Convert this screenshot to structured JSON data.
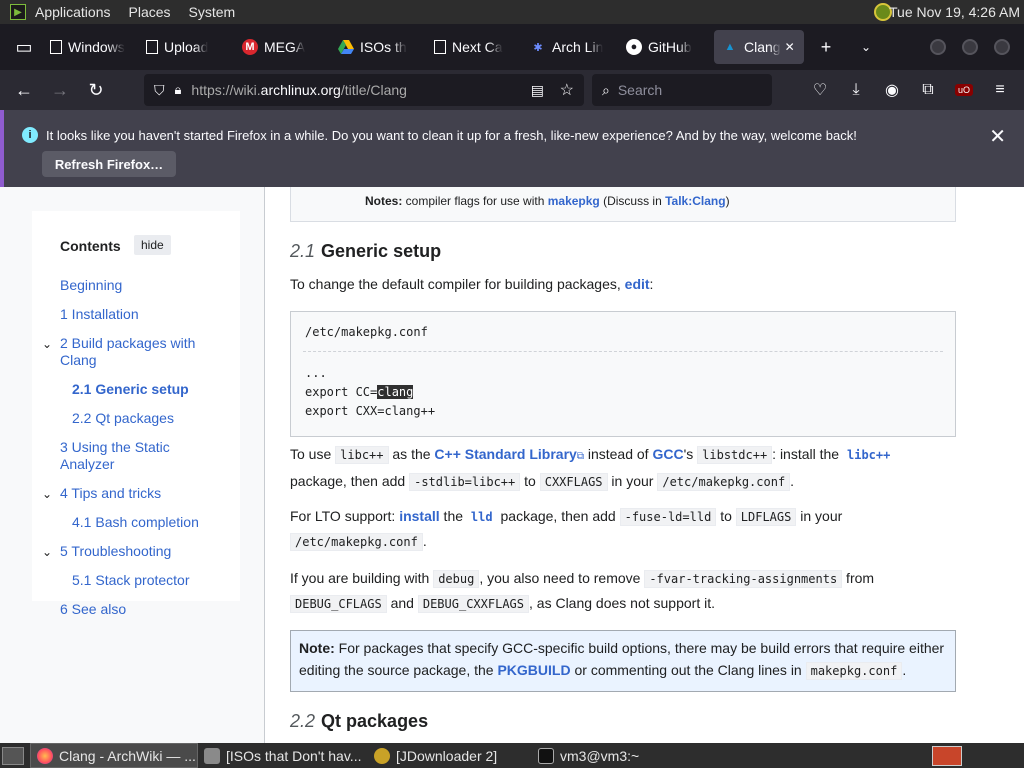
{
  "top_panel": {
    "menus": [
      "Applications",
      "Places",
      "System"
    ],
    "clock": "Tue Nov 19, 4:26 AM"
  },
  "tabs": [
    {
      "label": "Windows",
      "icon": "doc-icon"
    },
    {
      "label": "Upload",
      "icon": "doc-icon"
    },
    {
      "label": "MEGA",
      "icon": "mega-icon"
    },
    {
      "label": "ISOs th",
      "icon": "drive-icon"
    },
    {
      "label": "Next Ca",
      "icon": "doc-icon"
    },
    {
      "label": "Arch Lin",
      "icon": "bug-icon"
    },
    {
      "label": "GitHub",
      "icon": "github-icon"
    },
    {
      "label": "Clang",
      "icon": "arch-icon",
      "active": true
    }
  ],
  "nav": {
    "url_prefix": "https://wiki.",
    "url_domain": "archlinux.org",
    "url_path": "/title/Clang",
    "search_placeholder": "Search"
  },
  "notification": {
    "message": "It looks like you haven't started Firefox in a while. Do you want to clean it up for a fresh, like-new experience? And by the way, welcome back!",
    "button": "Refresh Firefox…"
  },
  "toc": {
    "title": "Contents",
    "hide": "hide",
    "items": [
      {
        "label": "Beginning"
      },
      {
        "label": "1  Installation"
      },
      {
        "label": "2  Build packages with",
        "label2": "Clang",
        "chevron": true
      },
      {
        "label": "2.1  Generic setup",
        "current": true
      },
      {
        "label": "2.2  Qt packages"
      },
      {
        "label": "3  Using the Static",
        "label2": "Analyzer"
      },
      {
        "label": "4  Tips and tricks",
        "chevron": true
      },
      {
        "label": "4.1  Bash completion"
      },
      {
        "label": "5  Troubleshooting",
        "chevron": true
      },
      {
        "label": "5.1  Stack protector"
      },
      {
        "label": "6  See also"
      }
    ]
  },
  "content": {
    "note_top": {
      "prefix": "Notes:",
      "text": " compiler flags for use with ",
      "link": "makepkg",
      "text2": " (Discuss in ",
      "link2": "Talk:Clang",
      "text3": ")"
    },
    "section1": {
      "num": "2.1",
      "title": "Generic setup"
    },
    "intro": {
      "text": "To change the default compiler for building packages, ",
      "link": "edit",
      "tail": ":"
    },
    "code_file": "/etc/makepkg.conf",
    "code_lines": [
      "...",
      "export CC=",
      "clang",
      "export CXX=clang++"
    ],
    "p1": {
      "a": "To use ",
      "c1": "libc++",
      "b": " as the ",
      "l1": "C++ Standard Library",
      "c": " instead of ",
      "l2": "GCC",
      "d": "'s ",
      "c2": "libstdc++",
      "e": ": install the ",
      "l3": "libc++",
      "f": "package, then add ",
      "c3": "-stdlib=libc++",
      "g": " to ",
      "c4": "CXXFLAGS",
      "h": " in your ",
      "c5": "/etc/makepkg.conf",
      "i": "."
    },
    "p2": {
      "a": "For LTO support: ",
      "l1": "install",
      "b": " the ",
      "l2": "lld",
      "c": " package, then add ",
      "c1": "-fuse-ld=lld",
      "d": " to ",
      "c2": "LDFLAGS",
      "e": " in your",
      "c3": "/etc/makepkg.conf",
      "f": "."
    },
    "p3": {
      "a": "If you are building with ",
      "c1": "debug",
      "b": ", you also need to remove ",
      "c2": "-fvar-tracking-assignments",
      "c": " from",
      "c3": "DEBUG_CFLAGS",
      "d": " and ",
      "c4": "DEBUG_CXXFLAGS",
      "e": ", as Clang does not support it."
    },
    "note2": {
      "prefix": "Note:",
      "a": " For packages that specify GCC-specific build options, there may be build errors that require either editing the source package, the ",
      "link": "PKGBUILD",
      "b": " or commenting out the Clang lines in ",
      "code": "makepkg.conf",
      "c": "."
    },
    "section2": {
      "num": "2.2",
      "title": "Qt packages"
    }
  },
  "taskbar": [
    {
      "label": "Clang - ArchWiki — ...",
      "active": true,
      "icon": "firefox-icon"
    },
    {
      "label": "[ISOs that Don't hav...",
      "icon": "folder-icon"
    },
    {
      "label": "[JDownloader 2]",
      "icon": "jdownloader-icon"
    },
    {
      "label": "vm3@vm3:~",
      "icon": "terminal-icon"
    }
  ]
}
